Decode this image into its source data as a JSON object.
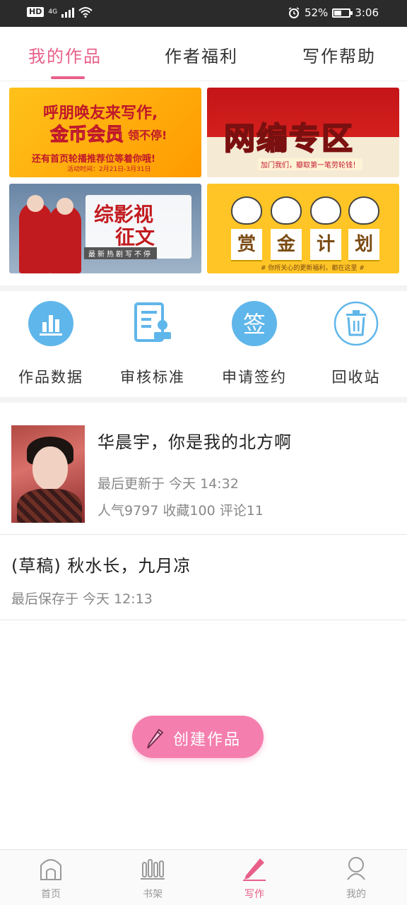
{
  "status_bar": {
    "hd": "HD",
    "network": "4G",
    "battery_percent": "52%",
    "battery_level": 0.52,
    "time": "3:06"
  },
  "tabs": [
    {
      "label": "我的作品",
      "active": true
    },
    {
      "label": "作者福利",
      "active": false
    },
    {
      "label": "写作帮助",
      "active": false
    }
  ],
  "banners": {
    "b1": {
      "line1": "呼朋唤友来写作,",
      "line2": "金币会员",
      "line2b": "领不停!",
      "line3": "还有首页轮播推荐位等着你哦!",
      "line4": "活动时间：2月21日-3月31日"
    },
    "b2": {
      "title": "网编专区",
      "sub": "加门我们，瓣取第一笔劳轮钱！"
    },
    "b3": {
      "line1": "综影视",
      "line2": "征文",
      "line3": "最新热剧写不停"
    },
    "b4": {
      "chars": [
        "赏",
        "金",
        "计",
        "划"
      ],
      "caption": "# 你所关心的更新福利，都在这里 #"
    }
  },
  "features": [
    {
      "label": "作品数据",
      "icon": "bar-chart-icon"
    },
    {
      "label": "审核标准",
      "icon": "document-stamp-icon"
    },
    {
      "label": "申请签约",
      "icon": "sign-icon",
      "icon_text": "签"
    },
    {
      "label": "回收站",
      "icon": "trash-icon"
    }
  ],
  "works": [
    {
      "title": "华晨宇，你是我的北方啊",
      "updated": "最后更新于 今天 14:32",
      "stats": "人气9797 收藏100 评论11"
    },
    {
      "title": "(草稿) 秋水长，九月凉",
      "saved": "最后保存于 今天 12:13"
    }
  ],
  "create_button": {
    "label": "创建作品"
  },
  "bottom_nav": [
    {
      "label": "首页",
      "icon": "home-icon",
      "active": false
    },
    {
      "label": "书架",
      "icon": "bookshelf-icon",
      "active": false
    },
    {
      "label": "写作",
      "icon": "pen-icon",
      "active": true
    },
    {
      "label": "我的",
      "icon": "profile-icon",
      "active": false
    }
  ],
  "colors": {
    "accent": "#e8608a",
    "create_button": "#f47fae",
    "feature_icon_blue": "#5fb6ea"
  }
}
